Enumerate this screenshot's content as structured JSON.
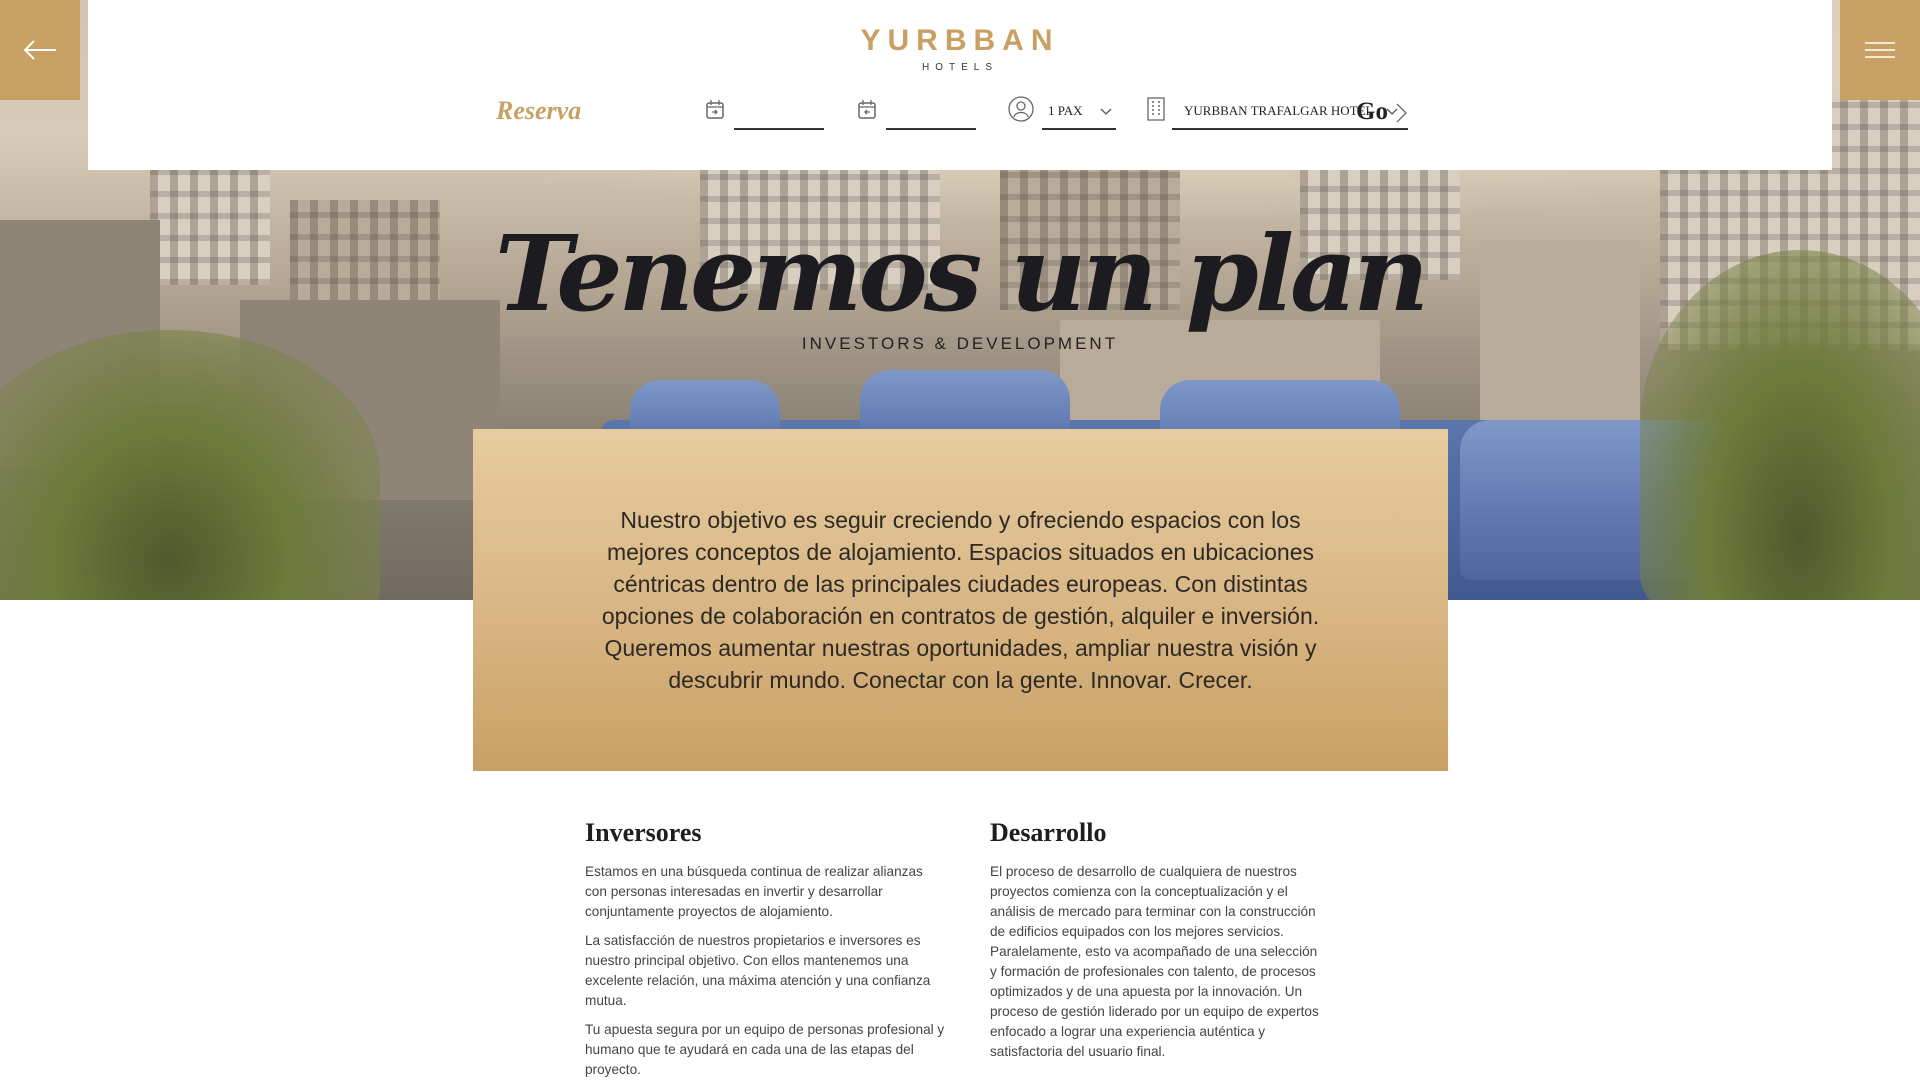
{
  "header": {
    "brand": "YURBBAN",
    "brand_sub": "HOTELS",
    "back_icon": "arrow-left-icon",
    "menu_icon": "hamburger-menu-icon"
  },
  "booking": {
    "reserva_label": "Reserva",
    "checkin_icon": "calendar-in-icon",
    "checkin_value": "",
    "checkout_icon": "calendar-out-icon",
    "checkout_value": "",
    "guests_icon": "user-icon",
    "guests_value": "1 PAX",
    "hotel_icon": "building-icon",
    "hotel_value": "YURBBAN TRAFALGAR HOTEL",
    "go_label": "Go",
    "go_icon": "chevron-right-icon"
  },
  "hero": {
    "title": "Tenemos un plan",
    "subtitle": "INVESTORS & DEVELOPMENT"
  },
  "intro": {
    "text": "Nuestro objetivo es seguir creciendo y ofreciendo espacios con los mejores conceptos de alojamiento. Espacios situados en ubicaciones céntricas dentro de las principales ciudades europeas. Con distintas opciones de colaboración en contratos de gestión, alquiler e inversión. Queremos aumentar nuestras oportunidades, ampliar nuestra visión y descubrir mundo. Conectar con la gente. Innovar. Crecer."
  },
  "investors": {
    "heading": "Inversores",
    "paragraphs": [
      "Estamos en una búsqueda continua de realizar alianzas con personas interesadas en invertir y desarrollar conjuntamente proyectos de alojamiento.",
      "La satisfacción de nuestros propietarios e inversores es nuestro principal objetivo. Con ellos mantenemos una excelente relación, una máxima atención y una confianza mutua.",
      "Tu apuesta segura por un equipo de personas profesional y humano que te ayudará en cada una de las etapas del proyecto."
    ]
  },
  "development": {
    "heading": "Desarrollo",
    "paragraphs": [
      "El proceso de desarrollo de cualquiera de nuestros proyectos comienza con la conceptualización y el análisis de mercado para terminar con la construcción de edificios equipados con los mejores servicios. Paralelamente, esto va acompañado de una selección y formación de profesionales con talento, de procesos optimizados y de una apuesta por la innovación. Un proceso de gestión liderado por un equipo de expertos enfocado a lograr una experiencia auténtica y satisfactoria del usuario final."
    ]
  },
  "colors": {
    "gold": "#c9a063",
    "dark": "#1c1b20"
  }
}
